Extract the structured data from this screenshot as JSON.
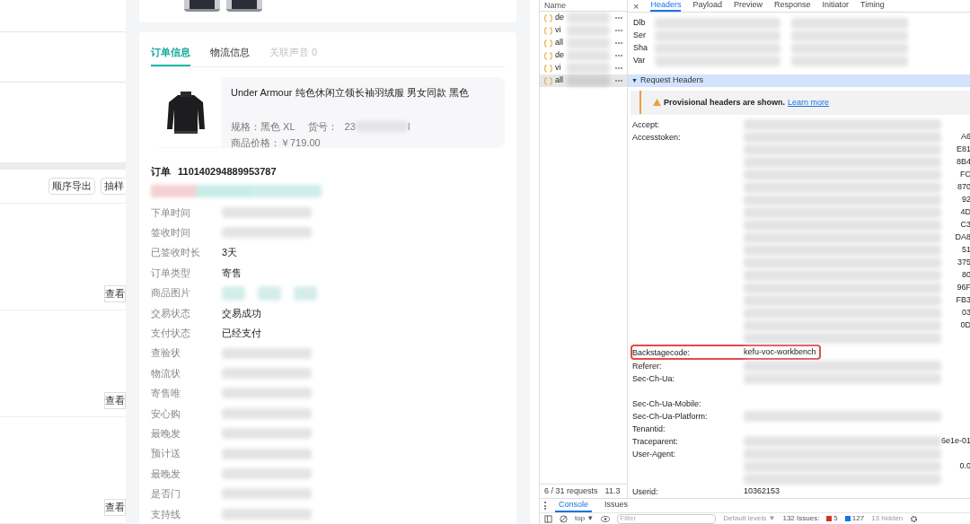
{
  "left_panel": {
    "buttons": [
      {
        "label": "顺序导出"
      },
      {
        "label": "抽样"
      }
    ],
    "view_buttons": [
      "查看",
      "查看",
      "查看"
    ]
  },
  "drawer": {
    "tabs": [
      {
        "label": "订单信息",
        "selected": true,
        "disabled": false
      },
      {
        "label": "物流信息",
        "selected": false,
        "disabled": false
      },
      {
        "label": "关联声音 0",
        "selected": false,
        "disabled": true
      }
    ],
    "product": {
      "title": "Under Armour 纯色休闲立领长袖羽绒服 男女同款 黑色",
      "spec_label": "规格：",
      "spec": "黑色 XL",
      "sku_label": "货号：",
      "sku_prefix": "23",
      "sku_suffix": "I",
      "price_label": "商品价格：",
      "price": "￥719.00"
    },
    "order": {
      "label": "订单",
      "number": "110140294889953787"
    },
    "fields": [
      {
        "label": "下单时间",
        "kind": "redacted"
      },
      {
        "label": "签收时间",
        "kind": "redacted"
      },
      {
        "label": "已签收时长",
        "kind": "text",
        "value": "3天"
      },
      {
        "label": "订单类型",
        "kind": "text",
        "value": "寄售"
      },
      {
        "label": "商品图片",
        "kind": "images"
      },
      {
        "label": "交易状态",
        "kind": "text",
        "value": "交易成功"
      },
      {
        "label": "支付状态",
        "kind": "text",
        "value": "已经支付"
      },
      {
        "label": "查验状",
        "kind": "redacted"
      },
      {
        "label": "物流状",
        "kind": "redacted"
      },
      {
        "label": "寄售唯",
        "kind": "redacted"
      },
      {
        "label": "安心购",
        "kind": "redacted"
      },
      {
        "label": "最晚发",
        "kind": "redacted"
      },
      {
        "label": "预计送",
        "kind": "redacted"
      },
      {
        "label": "最晚发",
        "kind": "redacted"
      },
      {
        "label": "是否门",
        "kind": "redacted"
      },
      {
        "label": "支持线",
        "kind": "redacted"
      }
    ]
  },
  "devtools": {
    "requests": {
      "header": "Name",
      "items": [
        {
          "name": "de",
          "selected": false
        },
        {
          "name": "vi",
          "selected": false
        },
        {
          "name": "all",
          "selected": false
        },
        {
          "name": "de",
          "selected": false
        },
        {
          "name": "vi",
          "selected": false
        },
        {
          "name": "all",
          "selected": true
        }
      ],
      "footer": "6 / 31 requests",
      "size": "11.3"
    },
    "close": "×",
    "tabs": [
      {
        "label": "Headers",
        "selected": true
      },
      {
        "label": "Payload",
        "selected": false
      },
      {
        "label": "Preview",
        "selected": false
      },
      {
        "label": "Response",
        "selected": false
      },
      {
        "label": "Initiator",
        "selected": false
      },
      {
        "label": "Timing",
        "selected": false
      }
    ],
    "response_headers": [
      "Dlb",
      "Ser",
      "Sha",
      "Var"
    ],
    "section": {
      "toggle": "▼",
      "title": "Request Headers",
      "expanded": true
    },
    "warning": {
      "text": "Provisional headers are shown.",
      "link": "Learn more"
    },
    "request_headers": [
      {
        "name": "Accept:",
        "lines": [
          {
            "kind": "blur"
          }
        ]
      },
      {
        "name": "Accesstoken:",
        "lines": [
          {
            "kind": "blur",
            "tail": "A6"
          },
          {
            "kind": "blur",
            "tail": "E81"
          },
          {
            "kind": "blur",
            "tail": "8B4"
          },
          {
            "kind": "blur",
            "tail": "FC"
          },
          {
            "kind": "blur",
            "tail": "870"
          },
          {
            "kind": "blur",
            "tail": "92"
          },
          {
            "kind": "blur",
            "tail": "4D"
          },
          {
            "kind": "blur",
            "tail": "C3"
          },
          {
            "kind": "blur",
            "tail": "DA8"
          },
          {
            "kind": "blur",
            "tail": "51"
          },
          {
            "kind": "blur",
            "tail": "375"
          },
          {
            "kind": "blur",
            "tail": "80"
          },
          {
            "kind": "blur",
            "tail": "96F"
          },
          {
            "kind": "blur",
            "tail": "FB3"
          },
          {
            "kind": "blur",
            "tail": "03"
          },
          {
            "kind": "blur",
            "tail": "0D"
          },
          {
            "kind": "blur"
          }
        ]
      },
      {
        "name": "Backstagecode:",
        "value": "kefu-voc-workbench",
        "highlighted": true
      },
      {
        "name": "Referer:",
        "lines": [
          {
            "kind": "blur"
          }
        ]
      },
      {
        "name": "Sec-Ch-Ua:",
        "lines": [
          {
            "kind": "blur"
          },
          {
            "kind": "blank"
          }
        ]
      },
      {
        "name": "Sec-Ch-Ua-Mobile:",
        "lines": [
          {
            "kind": "blank"
          }
        ]
      },
      {
        "name": "Sec-Ch-Ua-Platform:",
        "lines": [
          {
            "kind": "blur"
          }
        ]
      },
      {
        "name": "Tenantid:",
        "lines": [
          {
            "kind": "blank"
          }
        ]
      },
      {
        "name": "Traceparent:",
        "lines": [
          {
            "kind": "blur",
            "tail": "6e1e-01"
          }
        ]
      },
      {
        "name": "User-Agent:",
        "lines": [
          {
            "kind": "blur"
          },
          {
            "kind": "blur",
            "tail": "0.0"
          },
          {
            "kind": "blur"
          }
        ]
      },
      {
        "name": "Userid:",
        "value": "10362153",
        "highlighted": false
      }
    ],
    "drawer_tabs": [
      {
        "label": "Console",
        "selected": true
      },
      {
        "label": "Issues",
        "selected": false
      }
    ],
    "toolbar": {
      "context": "top ▼",
      "filter_placeholder": "Filter",
      "levels": "Default levels ▼",
      "issues_label": "132 Issues:",
      "errors": "5",
      "warnings": "127",
      "hidden": "13 hidden"
    }
  }
}
